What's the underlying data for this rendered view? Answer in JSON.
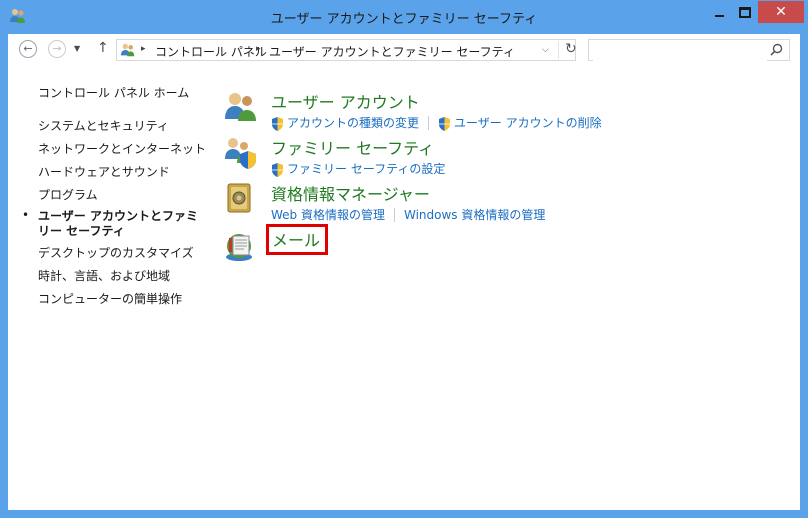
{
  "window": {
    "title": "ユーザー アカウントとファミリー セーフティ",
    "close_glyph": "✕",
    "colors": {
      "frame": "#5aa3eb",
      "close": "#c74b4b",
      "highlight": "#e10000",
      "category_title": "#1e7a1e",
      "link": "#1b6ec2"
    }
  },
  "nav": {
    "back_glyph": "←",
    "forward_glyph": "→",
    "recent_glyph": "▼",
    "up_glyph": "↑"
  },
  "address": {
    "breadcrumbs": [
      "コントロール パネル",
      "ユーザー アカウントとファミリー セーフティ"
    ],
    "separator": "▸",
    "dropdown_glyph": "⌵",
    "refresh_glyph": "↻"
  },
  "search": {
    "value": "",
    "icon": "search-icon",
    "glyph": "🔍"
  },
  "sidebar": {
    "home": "コントロール パネル ホーム",
    "items": [
      "システムとセキュリティ",
      "ネットワークとインターネット",
      "ハードウェアとサウンド",
      "プログラム",
      "ユーザー アカウントとファミリー セーフティ",
      "デスクトップのカスタマイズ",
      "時計、言語、および地域",
      "コンピューターの簡単操作"
    ],
    "current_index": 4,
    "bullet": "•"
  },
  "categories": [
    {
      "title": "ユーザー アカウント",
      "icon": "user-accounts-icon",
      "links": [
        {
          "label": "アカウントの種類の変更",
          "shield": true
        },
        {
          "label": "ユーザー アカウントの削除",
          "shield": true
        }
      ]
    },
    {
      "title": "ファミリー セーフティ",
      "icon": "family-safety-icon",
      "links": [
        {
          "label": "ファミリー セーフティの設定",
          "shield": true
        }
      ]
    },
    {
      "title": "資格情報マネージャー",
      "icon": "credential-manager-icon",
      "links": [
        {
          "label": "Web 資格情報の管理",
          "shield": false
        },
        {
          "label": "Windows 資格情報の管理",
          "shield": false
        }
      ]
    },
    {
      "title": "メール",
      "icon": "mail-icon",
      "highlighted": true,
      "links": []
    }
  ]
}
